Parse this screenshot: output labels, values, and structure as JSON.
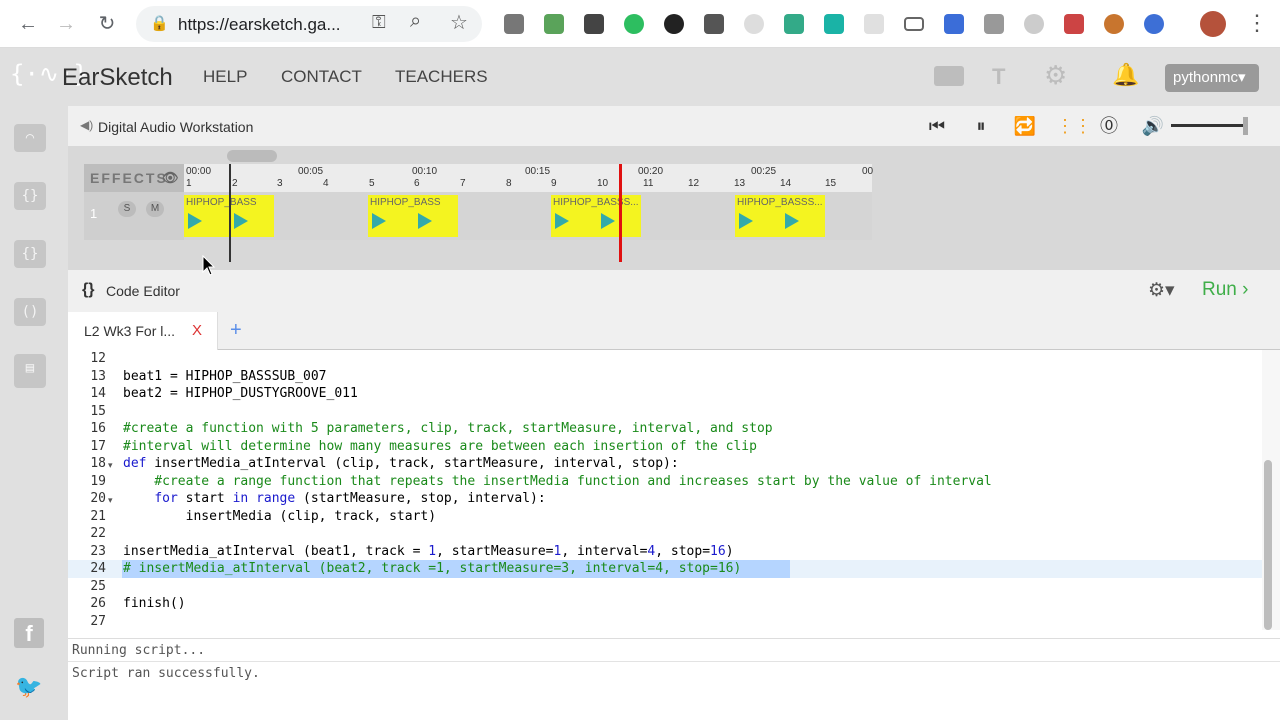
{
  "browser": {
    "url": "https://earsketch.ga...",
    "back_glyph": "←",
    "forward_glyph": "→",
    "reload_glyph": "↻",
    "lock_glyph": "🔒",
    "key_glyph": "⚿",
    "zoom_glyph": "⌕",
    "star_glyph": "☆",
    "menu_glyph": "⋮"
  },
  "app": {
    "logo": "{·∿·}",
    "title": "EarSketch",
    "nav": [
      "HELP",
      "CONTACT",
      "TEACHERS"
    ],
    "user": "pythonmc",
    "user_caret": "▾"
  },
  "daw": {
    "title": "Digital Audio Workstation",
    "effects_label": "EFFECTS",
    "track_number": "1",
    "solo": "S",
    "mute": "M",
    "time_ticks": [
      "00:00",
      "00:05",
      "00:10",
      "00:15",
      "00:20",
      "00:25",
      "00"
    ],
    "measure_ticks": [
      "1",
      "2",
      "3",
      "4",
      "5",
      "6",
      "7",
      "8",
      "9",
      "10",
      "11",
      "12",
      "13",
      "14",
      "15"
    ],
    "clip_label": "HIPHOP_BASSS...",
    "clip_label_short": "HIPHOP_BASS",
    "controls": {
      "rewind": "⏮",
      "pause": "⏸",
      "loop": "🔁",
      "metronome": "⓪",
      "volume": "🔊"
    },
    "volume_level": 1.0
  },
  "editor": {
    "title": "Code Editor",
    "braces": "{}",
    "run_label": "Run ›",
    "gear": "⚙▾",
    "tab_label": "L2 Wk3 For l...",
    "tab_close": "X",
    "tab_add": "+",
    "lines": [
      {
        "n": "12",
        "text": ""
      },
      {
        "n": "13",
        "text": "beat1 = HIPHOP_BASSSUB_007"
      },
      {
        "n": "14",
        "text": "beat2 = HIPHOP_DUSTYGROOVE_011"
      },
      {
        "n": "15",
        "text": ""
      },
      {
        "n": "16",
        "text": "#create a function with 5 parameters, clip, track, startMeasure, interval, and stop"
      },
      {
        "n": "17",
        "text": "#interval will determine how many measures are between each insertion of the clip"
      },
      {
        "n": "18",
        "text": "def insertMedia_atInterval (clip, track, startMeasure, interval, stop):"
      },
      {
        "n": "19",
        "text": "    #create a range function that repeats the insertMedia function and increases start by the value of interval"
      },
      {
        "n": "20",
        "text": "    for start in range (startMeasure, stop, interval):"
      },
      {
        "n": "21",
        "text": "        insertMedia (clip, track, start)"
      },
      {
        "n": "22",
        "text": ""
      },
      {
        "n": "23",
        "text": "insertMedia_atInterval (beat1, track = 1, startMeasure=1, interval=4, stop=16)"
      },
      {
        "n": "24",
        "text": "# insertMedia_atInterval (beat2, track =1, startMeasure=3, interval=4, stop=16)"
      },
      {
        "n": "25",
        "text": ""
      },
      {
        "n": "26",
        "text": "finish()"
      },
      {
        "n": "27",
        "text": ""
      }
    ]
  },
  "console": {
    "lines": [
      "Running script...",
      "Script ran successfully."
    ]
  },
  "colors": {
    "run_green": "#3fae49",
    "playhead_red": "#e01010",
    "clip_yellow": "#f4f420"
  }
}
